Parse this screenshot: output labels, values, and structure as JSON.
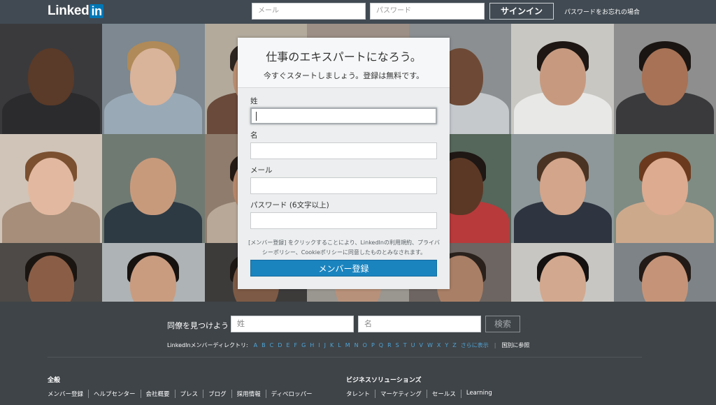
{
  "header": {
    "logo_text": "Linked",
    "logo_in": "in",
    "email_placeholder": "メール",
    "password_placeholder": "パスワード",
    "signin_label": "サインイン",
    "forgot_label": "パスワードをお忘れの場合"
  },
  "signup": {
    "title": "仕事のエキスパートになろう。",
    "subtitle": "今すぐスタートしましょう。登録は無料です。",
    "last_name_label": "姓",
    "first_name_label": "名",
    "email_label": "メール",
    "password_label": "パスワード (6文字以上)",
    "terms_text": "[メンバー登録] をクリックすることにより、LinkedInの利用規約、プライバシーポリシー、Cookieポリシーに同意したものとみなされます。",
    "join_label": "メンバー登録"
  },
  "find": {
    "label": "同僚を見つけよう",
    "last_name_placeholder": "姓",
    "first_name_placeholder": "名",
    "search_label": "検索"
  },
  "directory": {
    "label": "LinkedInメンバーディレクトリ:",
    "letters": [
      "A",
      "B",
      "C",
      "D",
      "E",
      "F",
      "G",
      "H",
      "I",
      "J",
      "K",
      "L",
      "M",
      "N",
      "O",
      "P",
      "Q",
      "R",
      "S",
      "T",
      "U",
      "V",
      "W",
      "X",
      "Y",
      "Z"
    ],
    "more_label": "さらに表示",
    "country_label": "国別に参照"
  },
  "footer": {
    "general_heading": "全般",
    "general_links": [
      "メンバー登録",
      "ヘルプセンター",
      "会社概要",
      "プレス",
      "ブログ",
      "採用情報",
      "ディベロッパー"
    ],
    "business_heading": "ビジネスソリューションズ",
    "business_links": [
      "タレント",
      "マーケティング",
      "セールス",
      "Learning"
    ]
  },
  "colors": {
    "brand_blue": "#0077b5",
    "join_button": "#1a84bf",
    "header_bg": "#414a52",
    "footer_bg": "#3f4448"
  }
}
